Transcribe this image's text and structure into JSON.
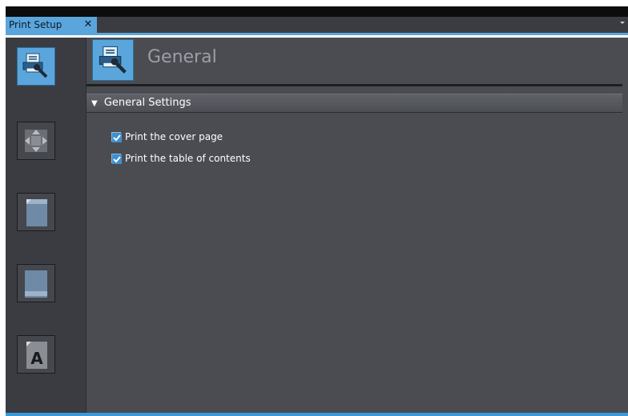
{
  "tab": {
    "title": "Print Setup",
    "close_glyph": "✕"
  },
  "nav": {
    "items": [
      {
        "id": "general",
        "icon": "printer-wrench-icon",
        "active": true
      },
      {
        "id": "layout",
        "icon": "move-arrows-icon",
        "active": false
      },
      {
        "id": "header",
        "icon": "page-header-icon",
        "active": false
      },
      {
        "id": "footer",
        "icon": "page-footer-icon",
        "active": false
      },
      {
        "id": "font",
        "icon": "font-page-icon",
        "active": false
      }
    ]
  },
  "section": {
    "title": "General",
    "icon": "printer-wrench-icon"
  },
  "group": {
    "arrow": "▼",
    "title": "General Settings"
  },
  "options": [
    {
      "label": "Print the cover page",
      "checked": true
    },
    {
      "label": "Print the table of contents",
      "checked": true
    }
  ],
  "colors": {
    "accent": "#5aa6dc",
    "background": "#4a4c52",
    "nav_bg": "#3a3c42"
  }
}
